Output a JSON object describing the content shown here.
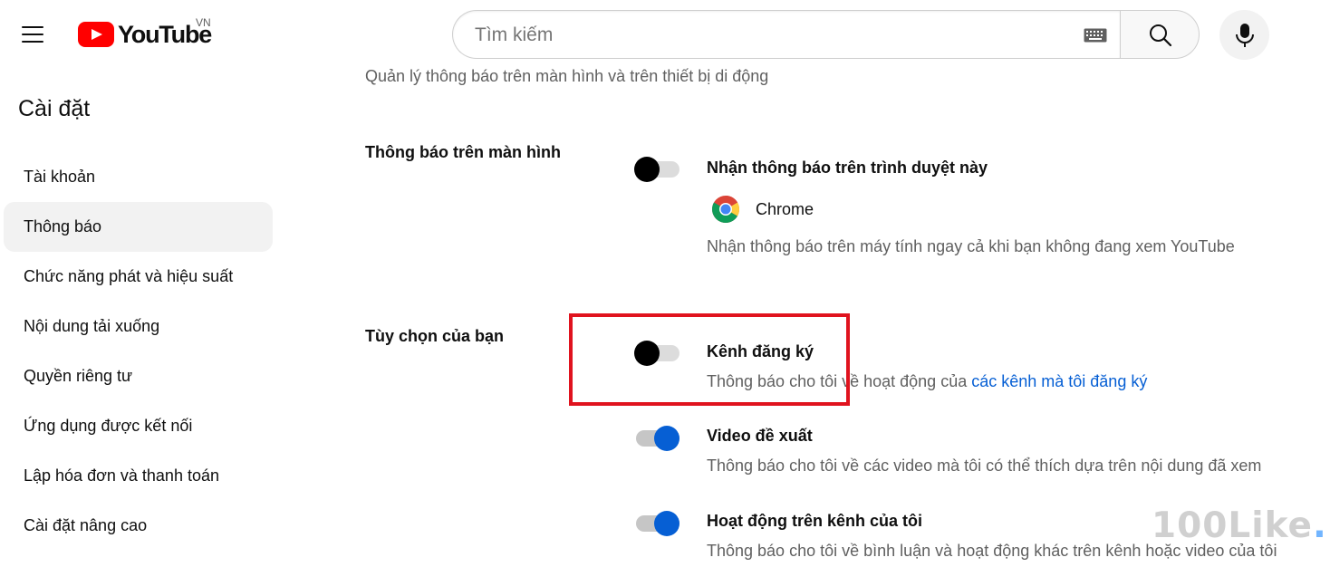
{
  "header": {
    "logo_text": "YouTube",
    "country_code": "VN",
    "search_placeholder": "Tìm kiếm",
    "brand_color": "#ff0000"
  },
  "sidebar": {
    "title": "Cài đặt",
    "items": [
      {
        "label": "Tài khoản",
        "active": false
      },
      {
        "label": "Thông báo",
        "active": true
      },
      {
        "label": "Chức năng phát và hiệu suất",
        "active": false
      },
      {
        "label": "Nội dung tải xuống",
        "active": false
      },
      {
        "label": "Quyền riêng tư",
        "active": false
      },
      {
        "label": "Ứng dụng được kết nối",
        "active": false
      },
      {
        "label": "Lập hóa đơn và thanh toán",
        "active": false
      },
      {
        "label": "Cài đặt nâng cao",
        "active": false
      }
    ]
  },
  "main": {
    "subtitle": "Quản lý thông báo trên màn hình và trên thiết bị di động",
    "desktop_section": {
      "label": "Thông báo trên màn hình",
      "option": {
        "title": "Nhận thông báo trên trình duyệt này",
        "enabled": false,
        "browser_name": "Chrome",
        "description": "Nhận thông báo trên máy tính ngay cả khi bạn không đang xem YouTube"
      }
    },
    "preferences_section": {
      "label": "Tùy chọn của bạn",
      "options": [
        {
          "title": "Kênh đăng ký",
          "enabled": false,
          "description": "Thông báo cho tôi về hoạt động của ",
          "link": "các kênh mà tôi đăng ký"
        },
        {
          "title": "Video đề xuất",
          "enabled": true,
          "description": "Thông báo cho tôi về các video mà tôi có thể thích dựa trên nội dung đã xem"
        },
        {
          "title": "Hoạt động trên kênh của tôi",
          "enabled": true,
          "description": "Thông báo cho tôi về bình luận và hoạt động khác trên kênh hoặc video của tôi"
        }
      ]
    }
  },
  "colors": {
    "toggle_on": "#065fd4",
    "link": "#065fd4",
    "highlight": "#e0131e"
  },
  "watermark": {
    "text": "100Like",
    "dot": "."
  }
}
